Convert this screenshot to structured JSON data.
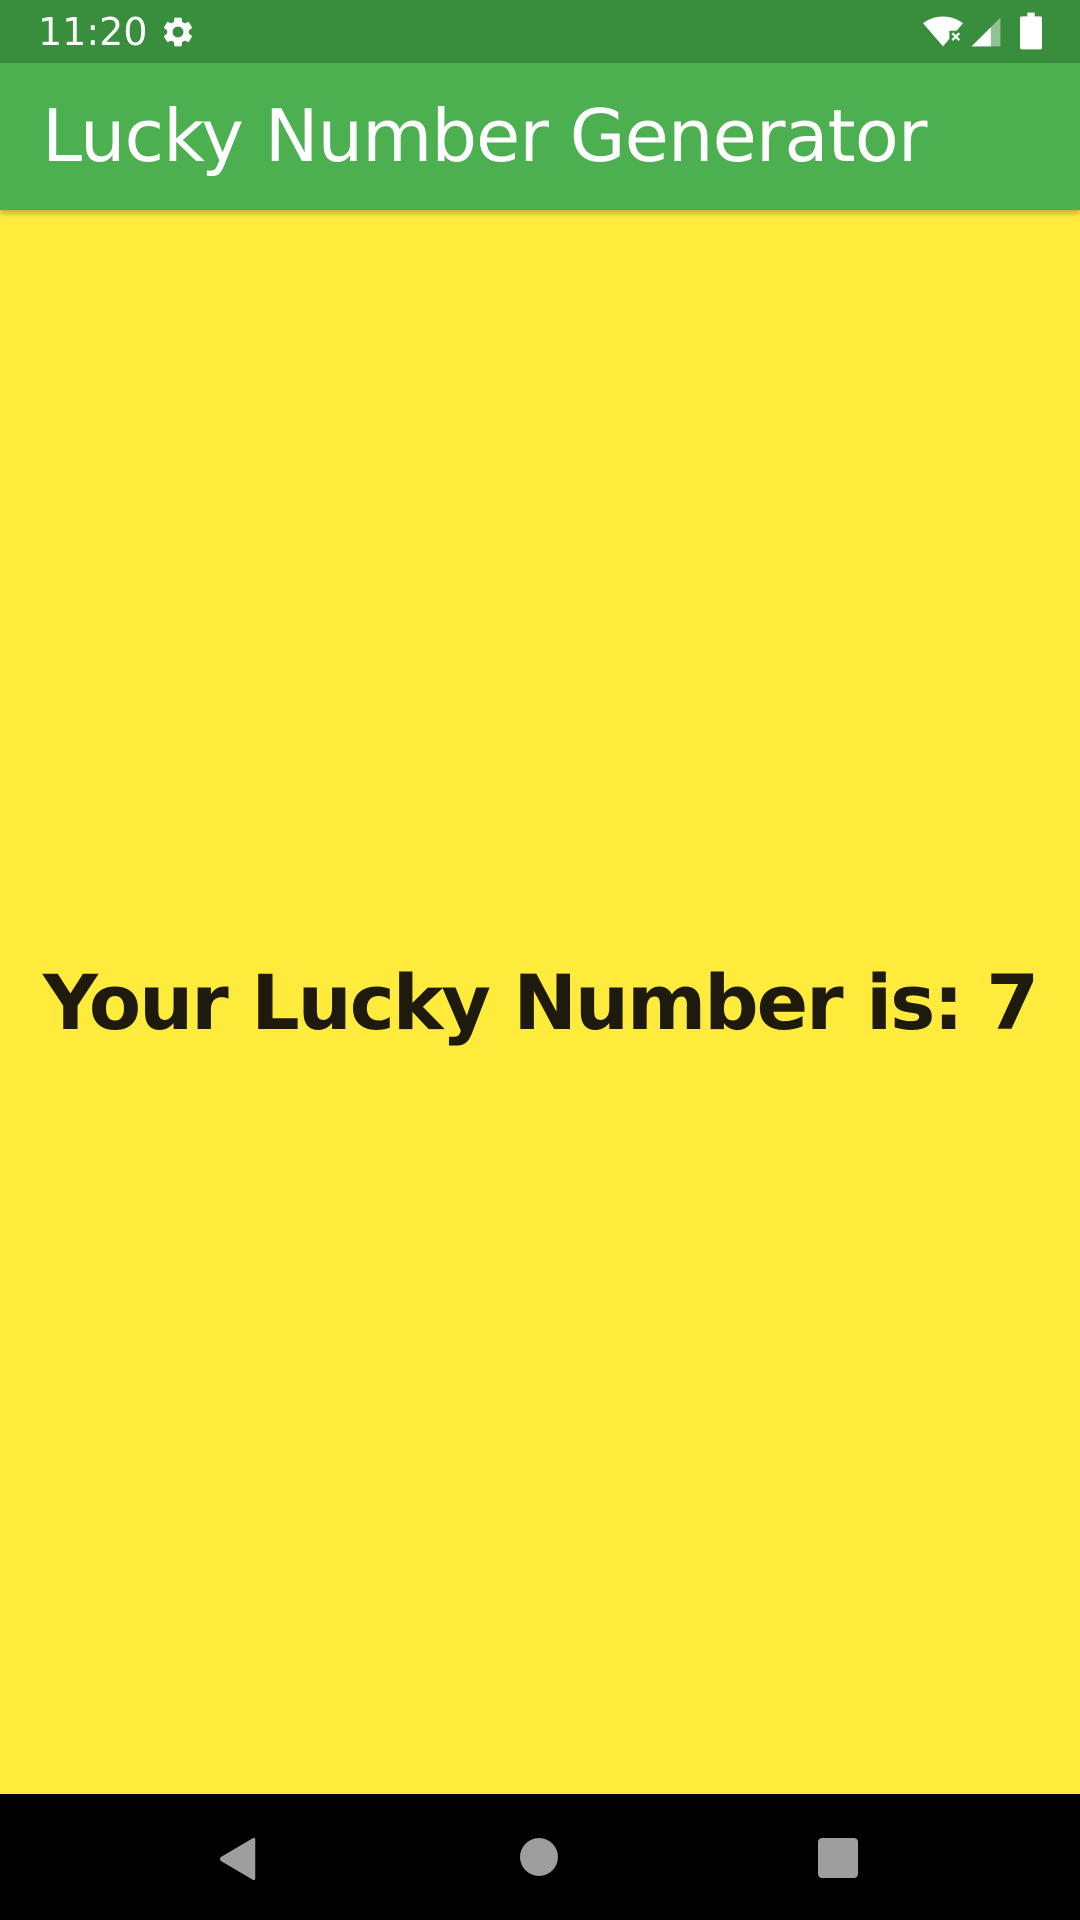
{
  "status_bar": {
    "time": "11:20",
    "icons": [
      "gear-icon",
      "wifi-icon",
      "signal-icon",
      "battery-icon"
    ],
    "background_color": "#388E3C"
  },
  "app_bar": {
    "title": "Lucky Number Generator",
    "background_color": "#4CAF50",
    "text_color": "#FFFFFF"
  },
  "content": {
    "lucky_label": "Your Lucky Number is: 7",
    "background_color": "#FFEB3B",
    "text_color": "#1E1A0E"
  },
  "nav_bar": {
    "icons": [
      "back-icon",
      "home-icon",
      "recents-icon"
    ],
    "background_color": "#000000"
  }
}
